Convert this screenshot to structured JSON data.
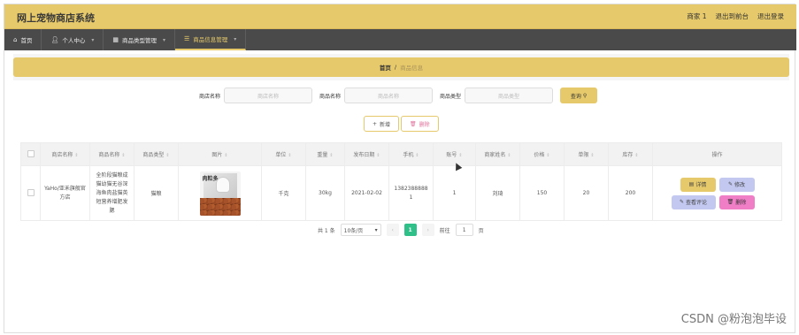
{
  "header": {
    "title": "网上宠物商店系统",
    "links": [
      "商家 1",
      "退出到前台",
      "退出登录"
    ]
  },
  "nav": {
    "items": [
      {
        "label": "首页",
        "icon": "home-icon"
      },
      {
        "label": "个人中心",
        "icon": "user-icon"
      },
      {
        "label": "商品类型管理",
        "icon": "box-icon"
      },
      {
        "label": "商品信息管理",
        "icon": "list-icon"
      }
    ]
  },
  "breadcrumb": {
    "home": "首页",
    "sep": "/",
    "current": "商品信息"
  },
  "search": {
    "fields": [
      {
        "label": "商店名称",
        "placeholder": "商店名称"
      },
      {
        "label": "商品名称",
        "placeholder": "商品名称"
      },
      {
        "label": "商品类型",
        "placeholder": "商品类型"
      }
    ],
    "button": "查询"
  },
  "actions": {
    "add": "新增",
    "delete": "删除"
  },
  "table": {
    "columns": [
      "商店名称",
      "商品名称",
      "商品类型",
      "图片",
      "单位",
      "重量",
      "发布日期",
      "手机",
      "账号",
      "商家姓名",
      "价格",
      "单限",
      "库存",
      "操作"
    ],
    "rows": [
      {
        "store": "YaHo/亚禾旗舰官方店",
        "product": "全阶段猫粮成猫幼猫无谷深海鱼肉盐猫英短营养增肥发腮",
        "type": "猫粮",
        "image_text": "肉粒多",
        "unit": "千克",
        "weight": "30kg",
        "date": "2021-02-02",
        "phone": "13823888881",
        "account": "1",
        "merchant": "刘琦",
        "price": "150",
        "limit": "20",
        "stock": "200"
      }
    ],
    "ops": {
      "detail": "详情",
      "edit": "修改",
      "comment": "查看评论",
      "remove": "删除"
    }
  },
  "pager": {
    "total": "共 1 条",
    "size": "10条/页",
    "current": "1",
    "goto": "前往",
    "goto_value": "1",
    "page_unit": "页"
  },
  "watermark": "CSDN @粉泡泡毕设",
  "colors": {
    "accent": "#e6c96a",
    "nav": "#4a4a4a",
    "pager": "#2fbf88",
    "remove": "#f07ec7",
    "edit": "#c2c8f0"
  }
}
